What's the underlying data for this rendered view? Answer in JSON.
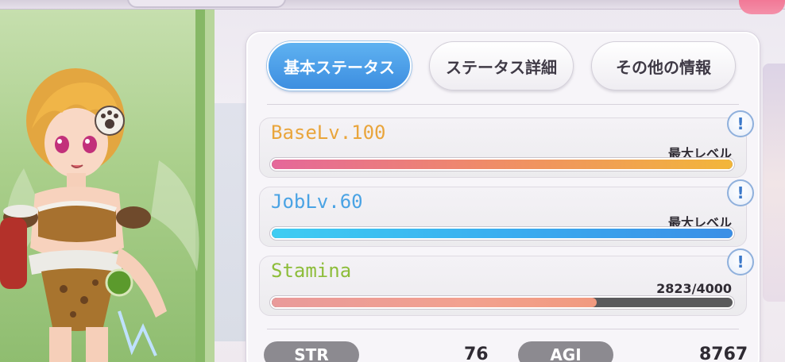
{
  "tabs": [
    {
      "label": "基本ステータス",
      "active": true
    },
    {
      "label": "ステータス詳細",
      "active": false
    },
    {
      "label": "その他の情報",
      "active": false
    }
  ],
  "stats": [
    {
      "label": "BaseLv.100",
      "value": "最大レベル",
      "label_color": "#e9a53c",
      "fill_percent": 100,
      "fill": "linear-gradient(90deg, #e5679a 0%, #ef8a6a 45%, #f2b63a 100%)"
    },
    {
      "label": "JobLv.60",
      "value": "最大レベル",
      "label_color": "#4aa3e4",
      "fill_percent": 100,
      "fill": "linear-gradient(90deg, #3ecdf2 0%, #3aaef0 50%, #3b8fe6 100%)"
    },
    {
      "label": "Stamina",
      "value": "2823/4000",
      "label_color": "#8dbd3a",
      "fill_percent": 70.6,
      "fill": "linear-gradient(90deg, #e99a9a 0%, #f2a18f 60%, #f19a7f 100%)"
    }
  ],
  "info_icon": {
    "name": "exclamation-icon",
    "glyph": "!"
  },
  "attributes": [
    {
      "label": "STR",
      "value": "76"
    },
    {
      "label": "AGI",
      "value": "8767"
    }
  ]
}
